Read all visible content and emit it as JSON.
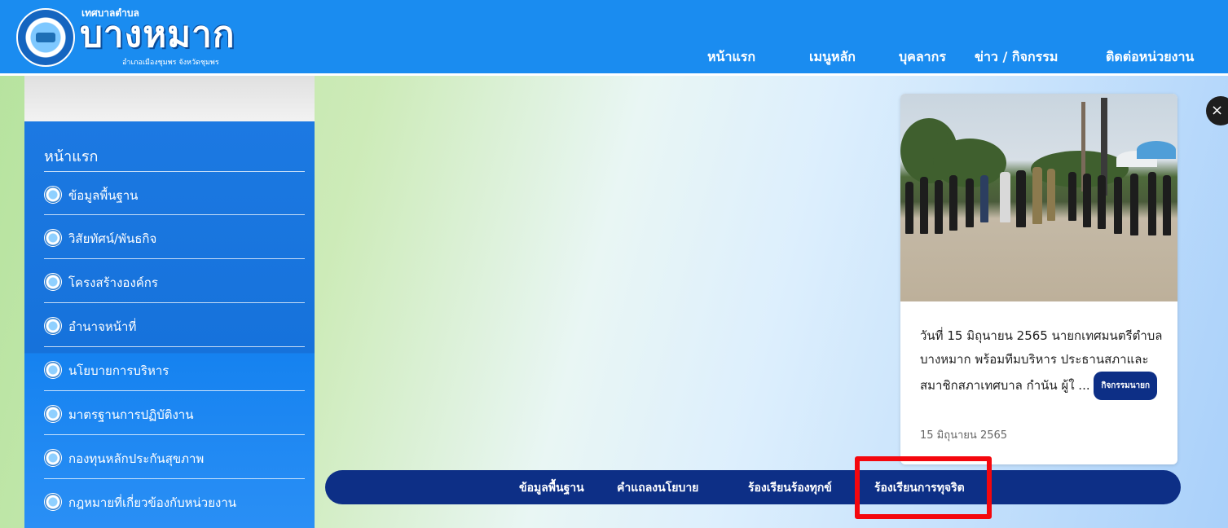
{
  "header": {
    "logo_small": "เทศบาลตำบล",
    "logo_big": "บางหมาก",
    "logo_sub": "อำเภอเมืองชุมพร จังหวัดชุมพร",
    "nav": [
      "หน้าแรก",
      "เมนูหลัก",
      "บุคลากร",
      "ข่าว / กิจกรรม",
      "ติดต่อหน่วยงาน"
    ]
  },
  "sidebar": {
    "title": "หน้าแรก",
    "items": [
      {
        "label": "ข้อมูลพื้นฐาน"
      },
      {
        "label": "วิสัยทัศน์/พันธกิจ"
      },
      {
        "label": "โครงสร้างองค์กร"
      },
      {
        "label": "อำนาจหน้าที่"
      },
      {
        "label": "นโยบายการบริหาร"
      },
      {
        "label": "มาตรฐานการปฏิบัติงาน"
      },
      {
        "label": "กองทุนหลักประกันสุขภาพ"
      },
      {
        "label": "กฎหมายที่เกี่ยวข้องกับหน่วยงาน"
      }
    ]
  },
  "news": {
    "text": "วันที่ 15 มิถุนายน 2565 นายกเทศมนตรีตำบลบางหมาก พร้อมทีมบริหาร ประธานสภาและสมาชิกสภาเทศบาล กำนัน ผู้ใ ...",
    "tag": "กิจกรรมนายก",
    "date": "15 มิถุนายน 2565"
  },
  "close_label": "×",
  "bottom_nav": [
    "ข้อมูลพื้นฐาน",
    "คำแถลงนโยบาย",
    "ร้องเรียนร้องทุกข์",
    "ร้องเรียนการทุจริต"
  ],
  "colors": {
    "header_blue": "#1a8cf0",
    "sidebar_blue": "#1c79e2",
    "navy": "#0d2f86",
    "highlight_red": "#f4070d"
  }
}
